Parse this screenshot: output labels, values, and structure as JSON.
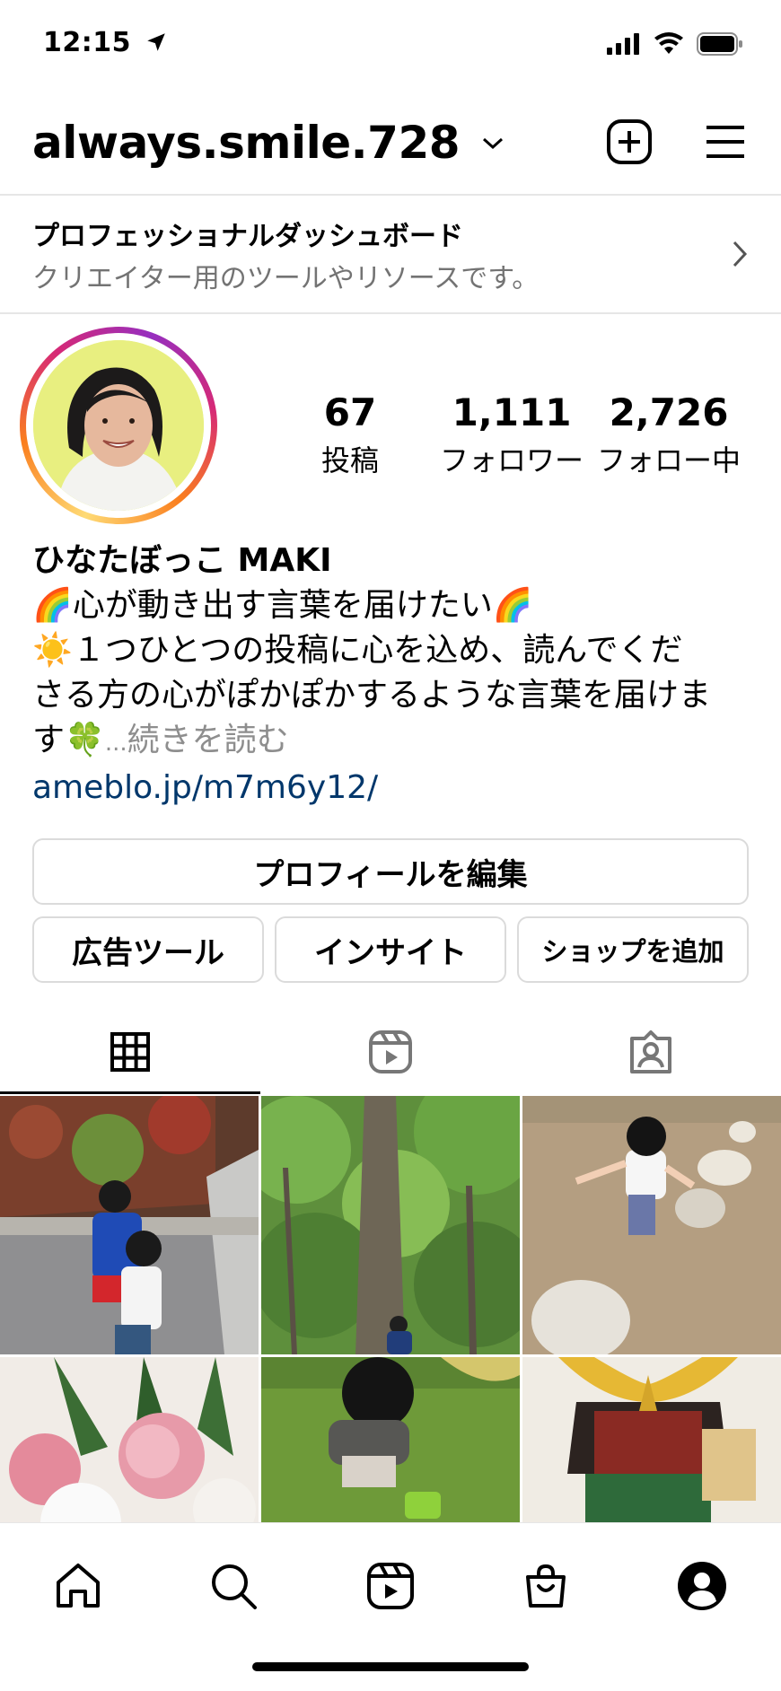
{
  "status_bar": {
    "time": "12:15"
  },
  "header": {
    "username": "always.smile.728"
  },
  "dashboard": {
    "title": "プロフェッショナルダッシュボード",
    "subtitle": "クリエイター用のツールやリソースです。"
  },
  "stats": [
    {
      "value": "67",
      "label": "投稿"
    },
    {
      "value": "1,111",
      "label": "フォロワー"
    },
    {
      "value": "2,726",
      "label": "フォロー中"
    }
  ],
  "bio": {
    "name": "ひなたぼっこ MAKI",
    "line1": "心が動き出す言葉を届けたい",
    "line2": "１つひとつの投稿に心を込め、読んでくだ",
    "line3": "さる方の心がぽかぽかするような言葉を届けま",
    "line4": "す",
    "ellipsis": "...",
    "more": "続きを読む",
    "link": "ameblo.jp/m7m6y12/",
    "emoji_rainbow": "🌈",
    "emoji_sun": "☀️",
    "emoji_clover": "🍀"
  },
  "buttons": {
    "edit_profile": "プロフィールを編集",
    "ad_tools": "広告ツール",
    "insights": "インサイト",
    "add_shop": "ショップを追加"
  },
  "tabs": [
    {
      "icon": "grid-icon",
      "active": true
    },
    {
      "icon": "reels-icon",
      "active": false
    },
    {
      "icon": "tagged-icon",
      "active": false
    }
  ],
  "colors": {
    "link": "#00376b",
    "secondary_text": "#737373",
    "border": "#dbdbdb",
    "avatar_bg": "#e7ee7e"
  },
  "nav": [
    "home-icon",
    "search-icon",
    "reels-icon",
    "shop-icon",
    "profile-icon"
  ]
}
